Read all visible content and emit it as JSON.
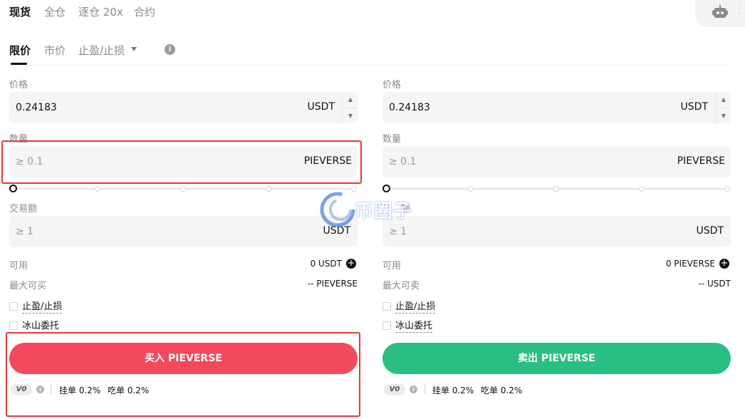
{
  "mode_tabs": [
    "现货",
    "全仓",
    "逐仓 20x",
    "合约"
  ],
  "order_types": {
    "limit": "限价",
    "market": "市价",
    "tpsl": "止盈/止损"
  },
  "buy": {
    "price_label": "价格",
    "price_value": "0.24183",
    "price_unit": "USDT",
    "qty_label": "数量",
    "qty_placeholder": "≥ 0.1",
    "qty_unit": "PIEVERSE",
    "amount_label": "交易额",
    "amount_placeholder": "≥ 1",
    "amount_unit": "USDT",
    "avail_label": "可用",
    "avail_value": "0 USDT",
    "max_label": "最大可买",
    "max_value": "-- PIEVERSE",
    "tpsl_label": "止盈/止损",
    "iceberg_label": "冰山委托",
    "button_label": "买入 PIEVERSE",
    "vip": "V0",
    "maker_fee": "挂单 0.2%",
    "taker_fee": "吃单 0.2%",
    "slider_percent": 0
  },
  "sell": {
    "price_label": "价格",
    "price_value": "0.24183",
    "price_unit": "USDT",
    "qty_label": "数量",
    "qty_placeholder": "≥ 0.1",
    "qty_unit": "PIEVERSE",
    "amount_label": "额",
    "amount_placeholder": "≥ 1",
    "amount_unit": "USDT",
    "avail_label": "可用",
    "avail_value": "0 PIEVERSE",
    "max_label": "最大可卖",
    "max_value": "-- USDT",
    "tpsl_label": "止盈/止损",
    "iceberg_label": "冰山委托",
    "button_label": "卖出 PIEVERSE",
    "vip": "V0",
    "maker_fee": "挂单 0.2%",
    "taker_fee": "吃单 0.2%",
    "slider_percent": 0
  },
  "icons": {
    "robot": "robot-icon",
    "info": "info-icon",
    "plus": "plus-circle-icon",
    "caret": "caret-down-icon"
  },
  "colors": {
    "buy": "#f2495d",
    "sell": "#29bf83",
    "highlight": "#e53935"
  },
  "watermark_text": "币圈子"
}
